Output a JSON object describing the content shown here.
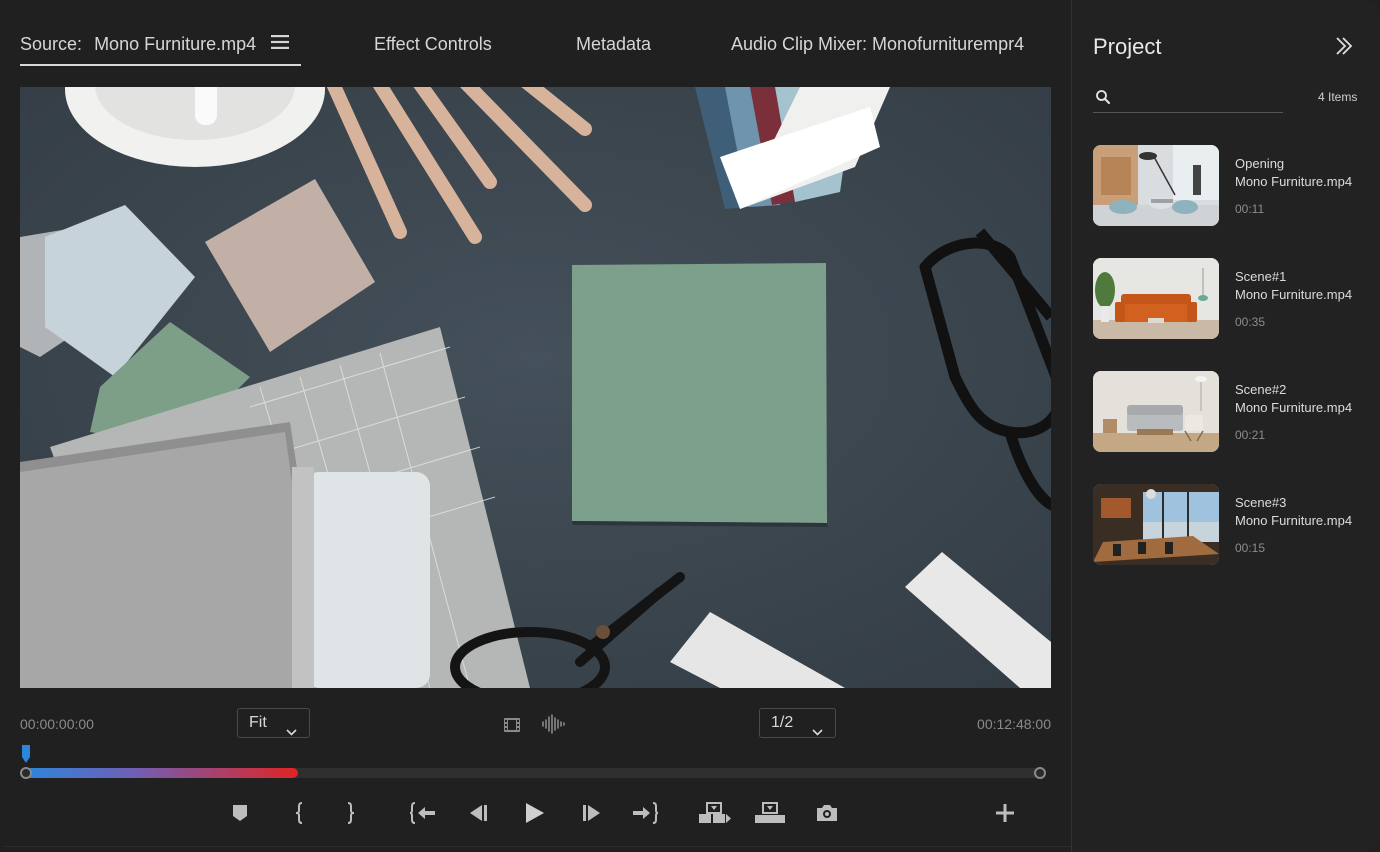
{
  "tabs": {
    "source_label": "Source:",
    "source_file": "Mono Furniture.mp4",
    "effect_controls": "Effect Controls",
    "metadata": "Metadata",
    "audio_mixer": "Audio Clip Mixer: Monofurniturempr4"
  },
  "timeline": {
    "current_time": "00:00:00:00",
    "duration": "00:12:48:00",
    "zoom": "Fit",
    "resolution": "1/2",
    "progress_fraction": 0.27
  },
  "project": {
    "title": "Project",
    "search_placeholder": "",
    "item_count": "4 Items",
    "clips": [
      {
        "name": "Opening",
        "file": "Mono Furniture.mp4",
        "duration": "00:11"
      },
      {
        "name": "Scene#1",
        "file": "Mono Furniture.mp4",
        "duration": "00:35"
      },
      {
        "name": "Scene#2",
        "file": "Mono Furniture.mp4",
        "duration": "00:21"
      },
      {
        "name": "Scene#3",
        "file": "Mono Furniture.mp4",
        "duration": "00:15"
      }
    ]
  },
  "icons": {
    "tab_menu": "hamburger-icon",
    "film": "film-icon",
    "waveform": "waveform-icon",
    "marker": "marker-icon",
    "mark_in": "mark-in-icon",
    "mark_out": "mark-out-icon",
    "go_to_in": "go-to-in-icon",
    "step_back": "step-back-icon",
    "play": "play-icon",
    "step_forward": "step-forward-icon",
    "go_to_out": "go-to-out-icon",
    "insert": "insert-icon",
    "overwrite": "overwrite-icon",
    "export_frame": "camera-icon",
    "add": "plus-icon",
    "collapse": "double-chevron-right-icon",
    "search": "search-icon"
  },
  "colors": {
    "background": "#202020",
    "progress_start": "#2d86db",
    "progress_end": "#e02424",
    "playhead": "#2d86db"
  }
}
